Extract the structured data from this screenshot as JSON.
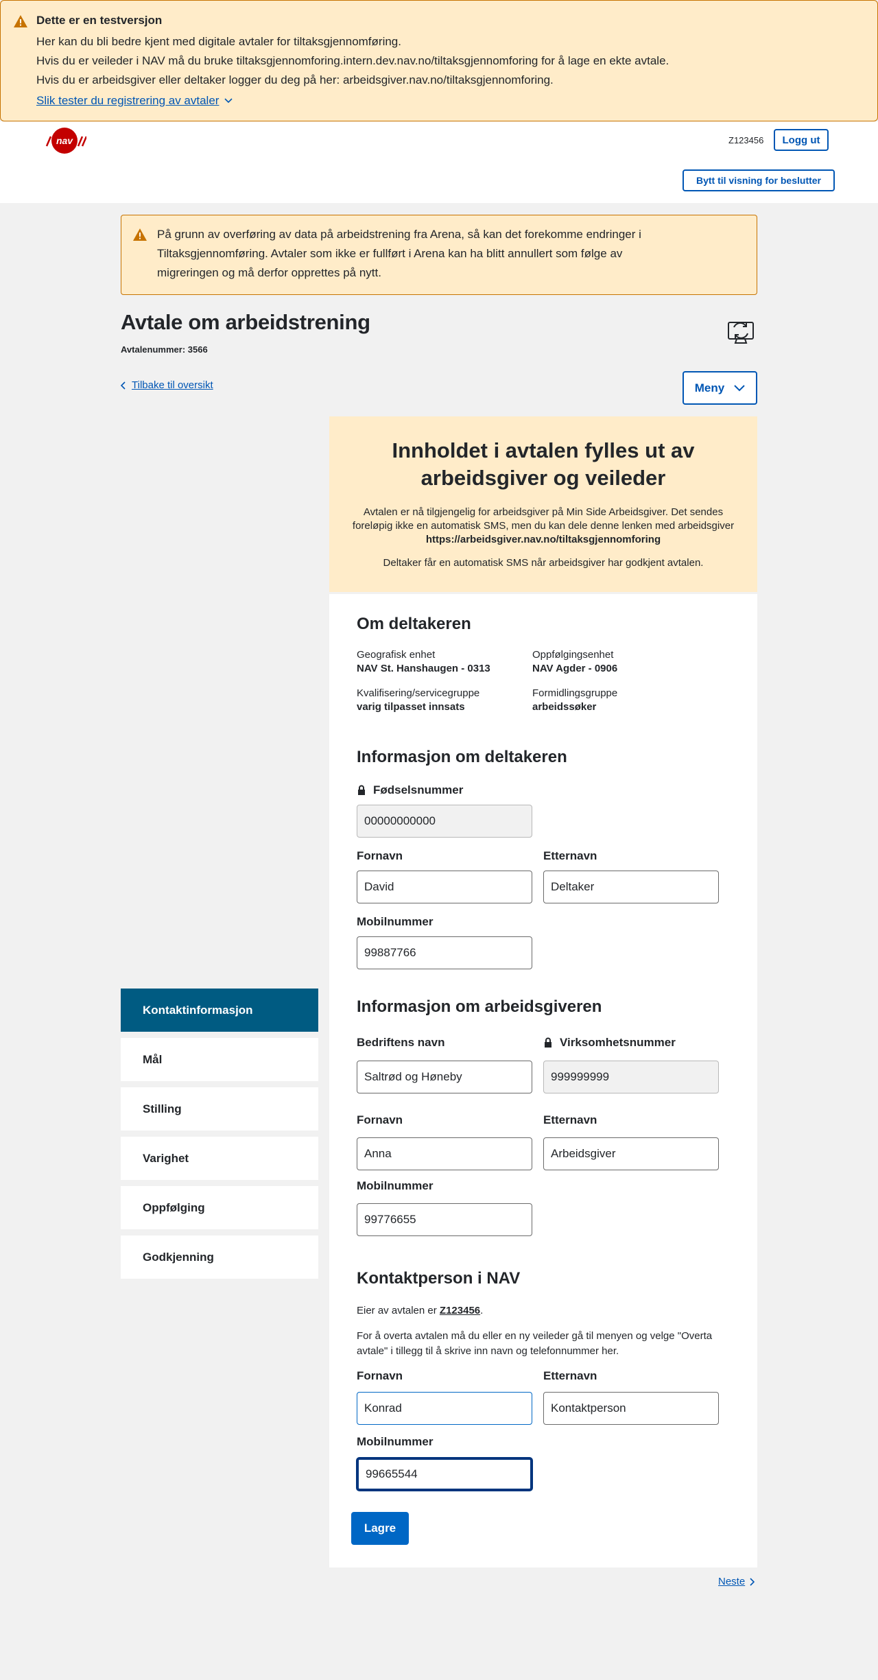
{
  "test_banner": {
    "title": "Dette er en testversjon",
    "line1": "Her kan du bli bedre kjent med digitale avtaler for tiltaksgjennomføring.",
    "line2": "Hvis du er veileder i NAV må du bruke tiltaksgjennomforing.intern.dev.nav.no/tiltaksgjennomforing for å lage en ekte avtale.",
    "line3": "Hvis du er arbeidsgiver eller deltaker logger du deg på her: arbeidsgiver.nav.no/tiltaksgjennomforing.",
    "link": "Slik tester du registrering av avtaler"
  },
  "header": {
    "logo_text": "nav",
    "user_id": "Z123456",
    "logout": "Logg ut",
    "switch_view": "Bytt til visning for beslutter"
  },
  "arena_alert": {
    "text": "På grunn av overføring av data på arbeidstrening fra Arena, så kan det forekomme endringer i Tiltaksgjennomføring. Avtaler som ikke er fullført i Arena kan ha blitt annullert som følge av migreringen og må derfor opprettes på nytt."
  },
  "page": {
    "title": "Avtale om arbeidstrening",
    "agreement_number": "Avtalenummer: 3566",
    "back_link": "Tilbake til oversikt",
    "menu": "Meny",
    "next": "Neste"
  },
  "sidenav": [
    {
      "label": "Kontaktinformasjon",
      "active": true
    },
    {
      "label": "Mål",
      "active": false
    },
    {
      "label": "Stilling",
      "active": false
    },
    {
      "label": "Varighet",
      "active": false
    },
    {
      "label": "Oppfølging",
      "active": false
    },
    {
      "label": "Godkjenning",
      "active": false
    }
  ],
  "info_box": {
    "heading": "Innholdet i avtalen fylles ut av arbeidsgiver og veileder",
    "text_part1": "Avtalen er nå tilgjengelig for arbeidsgiver på Min Side Arbeidsgiver. Det sendes foreløpig ikke en automatisk SMS, men du kan dele denne lenken med arbeidsgiver ",
    "url": "https://arbeidsgiver.nav.no/tiltaksgjennomforing",
    "text_part2": "Deltaker får en automatisk SMS når arbeidsgiver har godkjent avtalen."
  },
  "om_deltakeren": {
    "title": "Om deltakeren",
    "geo_label": "Geografisk enhet",
    "geo_value": "NAV St. Hanshaugen - 0313",
    "follow_label": "Oppfølgingsenhet",
    "follow_value": "NAV Agder - 0906",
    "qual_label": "Kvalifisering/servicegruppe",
    "qual_value": "varig tilpasset innsats",
    "group_label": "Formidlingsgruppe",
    "group_value": "arbeidssøker"
  },
  "deltaker": {
    "title": "Informasjon om deltakeren",
    "ssn_label": "Fødselsnummer",
    "ssn_value": "00000000000",
    "first_label": "Fornavn",
    "first_value": "David",
    "last_label": "Etternavn",
    "last_value": "Deltaker",
    "mobile_label": "Mobilnummer",
    "mobile_value": "99887766"
  },
  "arbeidsgiver": {
    "title": "Informasjon om arbeidsgiveren",
    "company_label": "Bedriftens navn",
    "company_value": "Saltrød og Høneby",
    "orgno_label": "Virksomhetsnummer",
    "orgno_value": "999999999",
    "first_label": "Fornavn",
    "first_value": "Anna",
    "last_label": "Etternavn",
    "last_value": "Arbeidsgiver",
    "mobile_label": "Mobilnummer",
    "mobile_value": "99776655"
  },
  "nav_kontakt": {
    "title": "Kontaktperson i NAV",
    "owner_prefix": "Eier av avtalen er ",
    "owner_id": "Z123456",
    "owner_suffix": ".",
    "takeover_text": "For å overta avtalen må du eller en ny veileder gå til menyen og velge \"Overta avtale\" i tillegg til å skrive inn navn og telefonnummer her.",
    "first_label": "Fornavn",
    "first_value": "Konrad",
    "last_label": "Etternavn",
    "last_value": "Kontaktperson",
    "mobile_label": "Mobilnummer",
    "mobile_value": "99665544",
    "save": "Lagre"
  },
  "colors": {
    "warning_bg": "#ffecc9",
    "warning_border": "#c77300",
    "nav_red": "#c30000",
    "link_blue": "#0056b4",
    "active_nav": "#005b82",
    "primary_button": "#0067c5"
  }
}
